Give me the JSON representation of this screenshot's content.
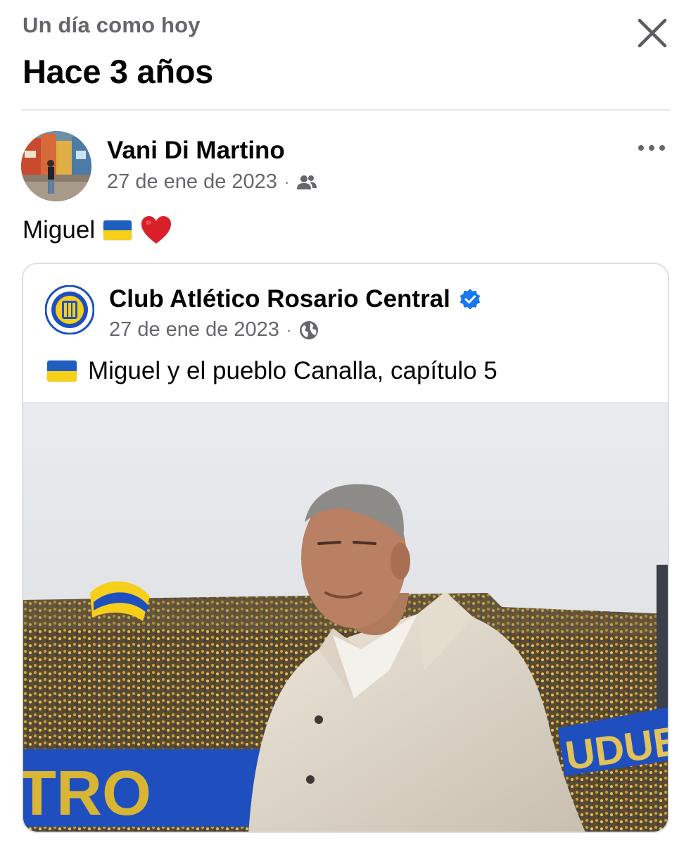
{
  "header": {
    "kicker": "Un día como hoy",
    "title": "Hace 3 años",
    "close_icon": "close-icon"
  },
  "post": {
    "author": "Vani Di Martino",
    "date": "27 de ene de 2023",
    "separator": "·",
    "audience_icon": "friends-icon",
    "more_icon": "more-options-icon",
    "text": "Miguel",
    "emoji": "❤️",
    "flag": "ukraine-flag-icon"
  },
  "shared": {
    "page_name": "Club Atlético Rosario Central",
    "verified_icon": "verified-badge-icon",
    "date": "27 de ene de 2023",
    "separator": "·",
    "audience_icon": "globe-icon",
    "text": "Miguel y el pueblo Canalla, capítulo 5",
    "flag": "ukraine-flag-icon",
    "photo_banner_left": "TRO",
    "photo_banner_right": "UDUE"
  },
  "colors": {
    "text_primary": "#050505",
    "text_secondary": "#65676b",
    "divider": "#e4e6eb",
    "verified_blue": "#1877f2",
    "club_blue": "#1f4fbf",
    "club_yellow": "#f6cf1a"
  }
}
